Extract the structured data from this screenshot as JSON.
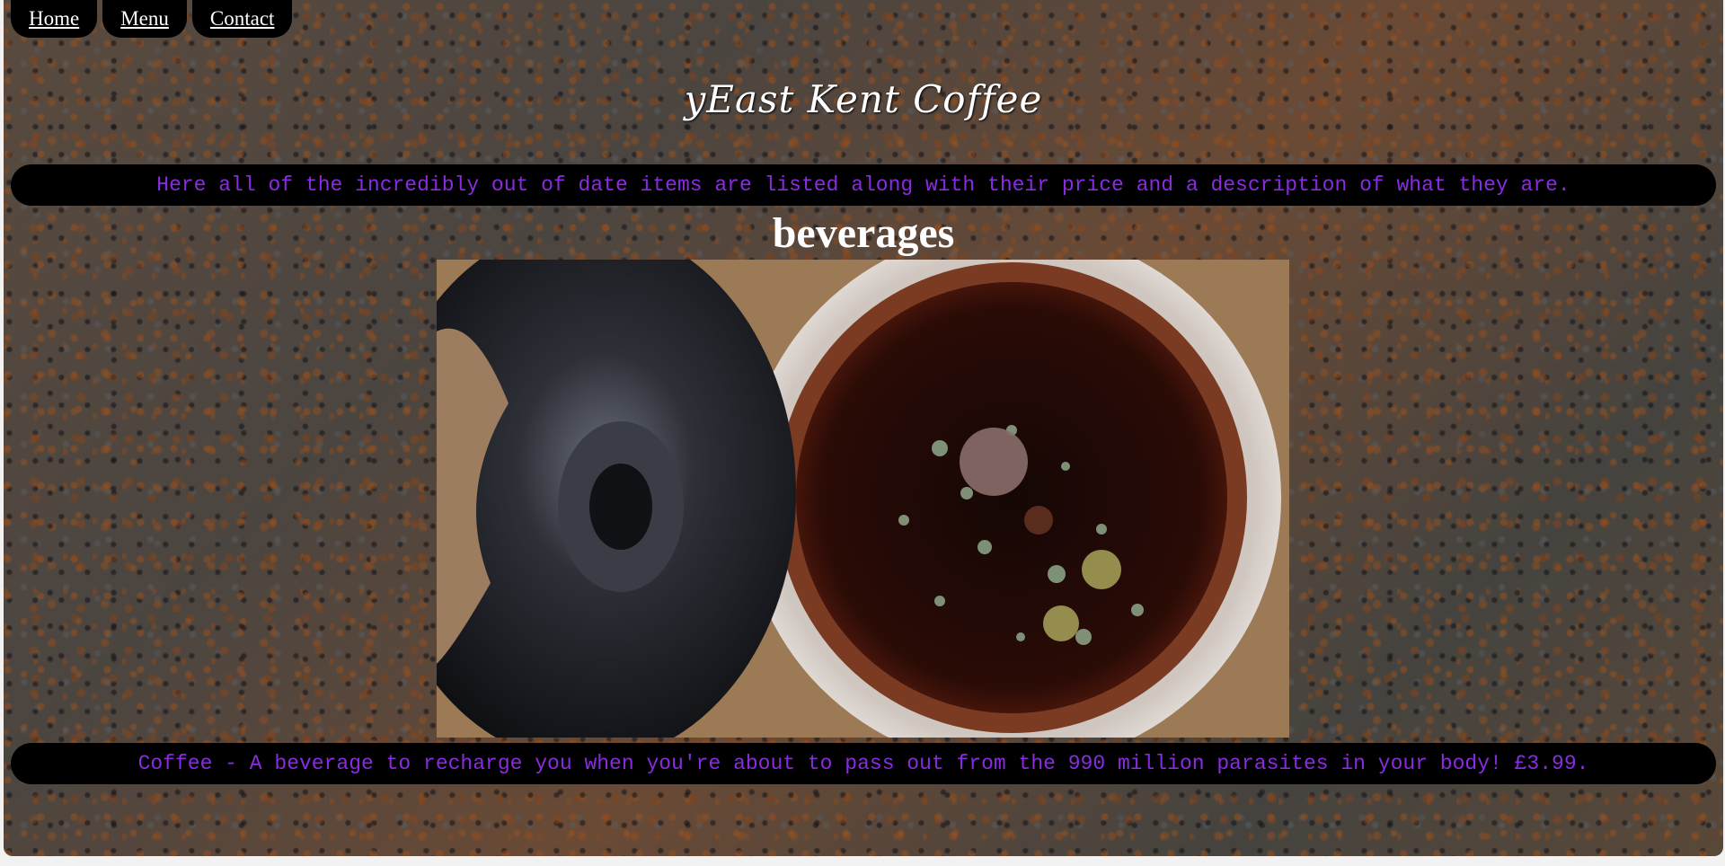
{
  "nav": {
    "items": [
      {
        "label": "Home"
      },
      {
        "label": "Menu"
      },
      {
        "label": "Contact"
      }
    ]
  },
  "logo": {
    "text": "yEast Kent Coffee"
  },
  "intro": {
    "text": "Here all of the incredibly out of date items are listed along with their price and a description of what they are."
  },
  "section": {
    "title": "beverages"
  },
  "items": [
    {
      "description": "Coffee - A beverage to recharge you when you're about to pass out from the 990 million parasites in your body! £3.99.",
      "image": "mouldy-coffee-pot-image"
    }
  ],
  "colors": {
    "banner_bg": "#000000",
    "banner_text": "#8a2be2",
    "heading_text": "#ffffff",
    "nav_bg": "#000000",
    "nav_text": "#ffffff"
  }
}
